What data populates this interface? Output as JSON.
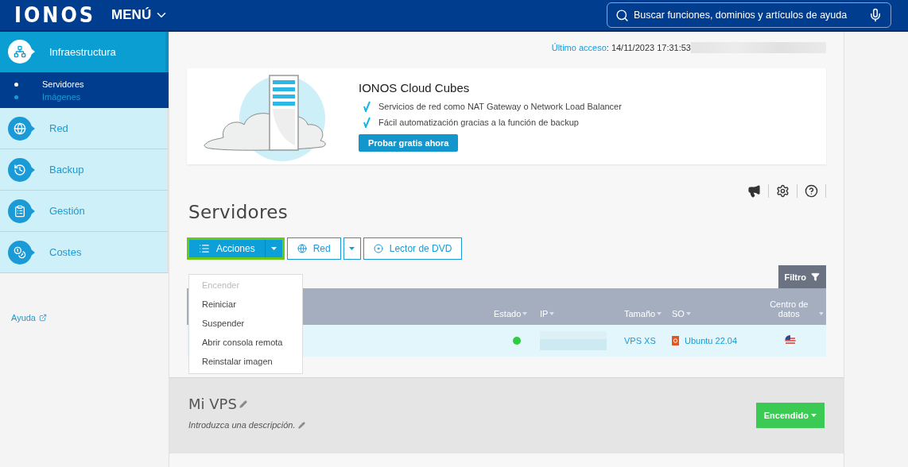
{
  "header": {
    "logo": "IONOS",
    "menu": "MENÚ",
    "search": {
      "placeholder": "Buscar funciones, dominios y artículos de ayuda"
    }
  },
  "sidebar": {
    "items": [
      {
        "kind": "infra",
        "label": "Infraestructura",
        "selected": true,
        "children": [
          {
            "label": "Servidores",
            "selected": true
          },
          {
            "label": "Imágenes",
            "selected": false
          }
        ]
      },
      {
        "kind": "network",
        "label": "Red",
        "selected": false
      },
      {
        "kind": "backup",
        "label": "Backup",
        "selected": false
      },
      {
        "kind": "manage",
        "label": "Gestión",
        "selected": false
      },
      {
        "kind": "costs",
        "label": "Costes",
        "selected": false
      }
    ],
    "help_link": "Ayuda"
  },
  "last_access": {
    "label": "Último acceso",
    "value": ": 14/11/2023 17:31:53"
  },
  "banner": {
    "title": "IONOS Cloud Cubes",
    "features": [
      "Servicios de red como NAT Gateway o Network Load Balancer",
      "Fácil automatización gracias a la función de backup"
    ],
    "button": "Probar gratis ahora"
  },
  "page_title": "Servidores",
  "toolbar": [
    {
      "kind": "actions",
      "label": "Acciones",
      "split": true,
      "highlighted": true
    },
    {
      "kind": "network",
      "label": "Red",
      "split": true,
      "highlighted": false
    },
    {
      "kind": "dvd",
      "label": "Lector de DVD",
      "split": false,
      "highlighted": false
    }
  ],
  "actions_menu": [
    {
      "label": "Encender",
      "disabled": true
    },
    {
      "label": "Reiniciar",
      "disabled": false
    },
    {
      "label": "Suspender",
      "disabled": false
    },
    {
      "label": "Abrir consola remota",
      "disabled": false
    },
    {
      "label": "Reinstalar imagen",
      "disabled": false
    }
  ],
  "filter_button": "Filtro",
  "table": {
    "columns": [
      "Estado",
      "IP",
      "Tamaño",
      "SO",
      "Centro de datos"
    ],
    "rows": [
      {
        "color": "#2ecc40",
        "size": "VPS XS",
        "os": "Ubuntu 22.04"
      }
    ]
  },
  "server_detail": {
    "name": "Mi VPS",
    "description_placeholder": "Introduzca una descripción.",
    "status_button": "Encendido"
  }
}
